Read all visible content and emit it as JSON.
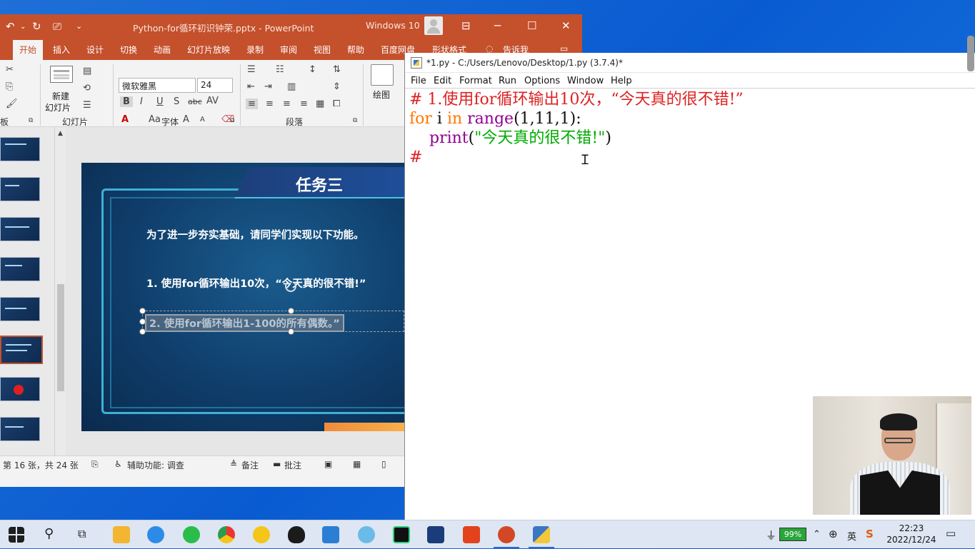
{
  "ppt": {
    "title": "Python-for循环初识钟荣.pptx  -  PowerPoint",
    "user": "Windows 10",
    "tabs": [
      "开始",
      "插入",
      "设计",
      "切换",
      "动画",
      "幻灯片放映",
      "录制",
      "审阅",
      "视图",
      "帮助",
      "百度网盘",
      "形状格式",
      "告诉我"
    ],
    "ribbon": {
      "new_slide": "新建",
      "new_slide2": "幻灯片",
      "group_slides": "幻灯片",
      "group_font": "字体",
      "group_paragraph": "段落",
      "group_clipboard": "板",
      "font_name": "微软雅黑",
      "font_size": "24",
      "draw": "绘图"
    },
    "slide": {
      "title": "任务三",
      "line1": "为了进一步夯实基础，请同学们实现以下功能。",
      "line2": "1. 使用for循环输出10次，“今天真的很不错!”",
      "line3": "2. 使用for循环输出1-100的所有偶数。”"
    },
    "status": {
      "slide_count": "第 16 张，共 24 张",
      "accessibility": "辅助功能: 调查",
      "notes": "备注",
      "comments": "批注"
    }
  },
  "idle": {
    "title": "*1.py - C:/Users/Lenovo/Desktop/1.py (3.7.4)*",
    "menu": [
      "File",
      "Edit",
      "Format",
      "Run",
      "Options",
      "Window",
      "Help"
    ],
    "code": {
      "l1": "# 1.使用for循环输出10次，“今天真的很不错!”",
      "l2_kw": "for",
      "l2_var": " i ",
      "l2_in": "in",
      "l2_sp": " ",
      "l2_range": "range",
      "l2_args": "(1,11,1):",
      "l3_indent": "    ",
      "l3_print": "print",
      "l3_open": "(",
      "l3_str": "\"今天真的很不错!\"",
      "l3_close": ")",
      "l4": "#"
    }
  },
  "taskbar": {
    "battery": "99%",
    "ime": "英",
    "time": "22:23",
    "date": "2022/12/24"
  },
  "colors": {
    "ppt_accent": "#c4502c",
    "desktop": "#0a5bd1",
    "idle_comment": "#dd2222",
    "idle_keyword": "#ff7700",
    "idle_builtin": "#900090",
    "idle_string": "#00aa00"
  }
}
